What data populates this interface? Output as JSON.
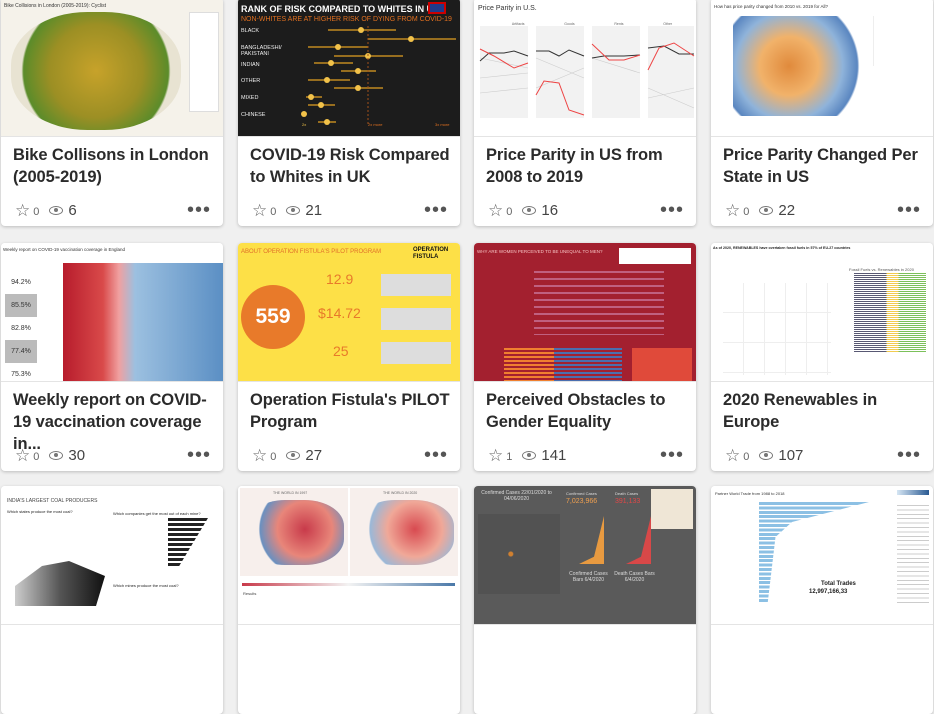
{
  "cards": [
    {
      "title": "Bike Collisons in London (2005-2019)",
      "favorites": "0",
      "views": "6",
      "thumb": {
        "heading": "Bike Collisions in London (2005-2019): Cyclist"
      }
    },
    {
      "title": "COVID-19 Risk Compared to Whites in UK",
      "favorites": "0",
      "views": "21",
      "thumb": {
        "heading": "RANK OF RISK COMPARED TO WHITES IN UK",
        "subheading": "NON-WHITES ARE AT HIGHER RISK OF DYING FROM COVID-19",
        "rows": [
          "BLACK",
          "BANGLADESHI/ PAKISTANI",
          "INDIAN",
          "OTHER",
          "MIXED",
          "CHINESE"
        ],
        "axis": [
          "2x",
          "2x more",
          "3x more"
        ]
      }
    },
    {
      "title": "Price Parity in US from 2008 to 2019",
      "favorites": "0",
      "views": "16",
      "thumb": {
        "heading": "Price Parity in U.S.",
        "panels": [
          "Artifacts",
          "Goods",
          "Rents",
          "Other"
        ]
      }
    },
    {
      "title": "Price Parity Changed Per State in US",
      "favorites": "0",
      "views": "22",
      "thumb": {
        "heading": "How has price parity changed from 2010 vs. 2019 for All?"
      }
    },
    {
      "title": "Weekly report on COVID-19 vaccination coverage in...",
      "favorites": "0",
      "views": "30",
      "thumb": {
        "heading": "Weekly report on COVID-19 vaccination coverage in England",
        "values": [
          "94.2%",
          "85.5%",
          "82.8%",
          "77.4%",
          "75.3%"
        ]
      }
    },
    {
      "title": "Operation Fistula's PILOT Program",
      "favorites": "0",
      "views": "27",
      "thumb": {
        "heading": "ABOUT OPERATION FISTULA'S PILOT PROGRAM",
        "logo": "OPERATION FISTULA",
        "big": "559",
        "kpis": [
          "12.9",
          "$14.72",
          "25"
        ]
      }
    },
    {
      "title": "Perceived Obstacles to Gender Equality",
      "favorites": "1",
      "views": "141",
      "thumb": {
        "heading": "WHY ARE WOMEN PERCEIVED TO BE UNEQUAL TO MEN?"
      }
    },
    {
      "title": "2020 Renewables in Europe",
      "favorites": "0",
      "views": "107",
      "thumb": {
        "heading": "As of 2020, RENEWABLES have overtaken fossil fuels in 57% of EU-27 countries",
        "chart_title": "Fossil Fuels vs. Renewables in 2020"
      }
    },
    {
      "title": "",
      "favorites": "",
      "views": "",
      "thumb": {
        "heading": "INDIA'S LARGEST COAL PRODUCERS",
        "q1": "Which states produce the most coal?",
        "q2": "Which companies get the most out of each mine?",
        "q3": "Which mines produce the most coal?"
      }
    },
    {
      "title": "",
      "favorites": "",
      "views": "",
      "thumb": {
        "left": "THE WORLD IN 1997",
        "right": "THE WORLD IN 2020",
        "bottom": "Results"
      }
    },
    {
      "title": "",
      "favorites": "",
      "views": "",
      "thumb": {
        "heading": "Confirmed Cases 22/01/2020 to 04/06/2020",
        "confirmed_label": "Confirmed Cases",
        "confirmed": "7,023,966",
        "death_label": "Death Cases",
        "deaths": "391,133",
        "bars1": "Confirmed Cases Bars 6/4/2020",
        "bars2": "Death Cases Bars 6/4/2020"
      }
    },
    {
      "title": "",
      "favorites": "",
      "views": "",
      "thumb": {
        "heading": "Partner World Trade from 1988 to 2018",
        "total_label": "Total Trades",
        "total": "12,997,166,33"
      }
    }
  ],
  "colors": {
    "covid_bg": "#1c1c1c",
    "fistula_bg": "#fde047",
    "gender_bg": "#a3202f",
    "covid_map_bg": "#5a5a5a"
  }
}
